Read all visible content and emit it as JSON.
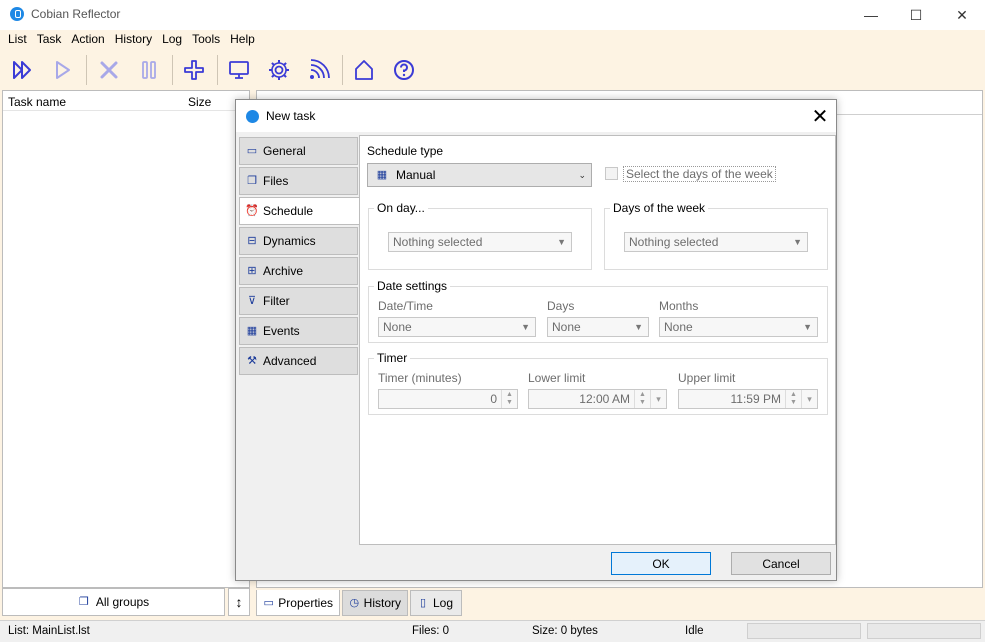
{
  "app": {
    "title": "Cobian Reflector",
    "window_controls": {
      "minimize": "—",
      "maximize": "☐",
      "close": "✕"
    }
  },
  "menu": [
    "List",
    "Task",
    "Action",
    "History",
    "Log",
    "Tools",
    "Help"
  ],
  "toolbar": {
    "icons": [
      "run-all-icon",
      "run-icon",
      "stop-icon",
      "pause-icon",
      "add-task-icon",
      "monitor-icon",
      "settings-icon",
      "remote-icon",
      "home-icon",
      "help-icon"
    ],
    "icon_color": "#3b3bd6",
    "icon_disabled_color": "#a8a8e8"
  },
  "task_list": {
    "col_task_name": "Task name",
    "col_size": "Size"
  },
  "bottom": {
    "groups_label": "All groups",
    "sort_glyph": "↕",
    "tabs": {
      "properties": "Properties",
      "history": "History",
      "log": "Log"
    }
  },
  "status": {
    "list": "List: MainList.lst",
    "files": "Files: 0",
    "size": "Size: 0 bytes",
    "state": "Idle"
  },
  "dialog": {
    "title": "New task",
    "close_glyph": "✕",
    "side_tabs": [
      {
        "label": "General",
        "icon": "general-icon",
        "glyph": "▭"
      },
      {
        "label": "Files",
        "icon": "files-icon",
        "glyph": "❐"
      },
      {
        "label": "Schedule",
        "icon": "alarm-clock-icon",
        "glyph": "⏰"
      },
      {
        "label": "Dynamics",
        "icon": "dynamics-icon",
        "glyph": "⊟"
      },
      {
        "label": "Archive",
        "icon": "archive-icon",
        "glyph": "⊞"
      },
      {
        "label": "Filter",
        "icon": "filter-icon",
        "glyph": "⊽"
      },
      {
        "label": "Events",
        "icon": "calendar-icon",
        "glyph": "▦"
      },
      {
        "label": "Advanced",
        "icon": "wrench-icon",
        "glyph": "⚒"
      }
    ],
    "active_tab": "Schedule",
    "schedule": {
      "schedule_type_label": "Schedule type",
      "schedule_type_value": "Manual",
      "select_days_label": "Select the days of the week",
      "on_day_title": "On day...",
      "on_day_value": "Nothing selected",
      "days_of_week_title": "Days of the week",
      "days_of_week_value": "Nothing selected",
      "date_settings_title": "Date settings",
      "date_time_label": "Date/Time",
      "date_time_value": "None",
      "days_label": "Days",
      "days_value": "None",
      "months_label": "Months",
      "months_value": "None",
      "timer_title": "Timer",
      "timer_minutes_label": "Timer (minutes)",
      "timer_minutes_value": "0",
      "lower_limit_label": "Lower limit",
      "lower_limit_value": "12:00 AM",
      "upper_limit_label": "Upper limit",
      "upper_limit_value": "11:59 PM"
    },
    "ok_label": "OK",
    "cancel_label": "Cancel"
  }
}
